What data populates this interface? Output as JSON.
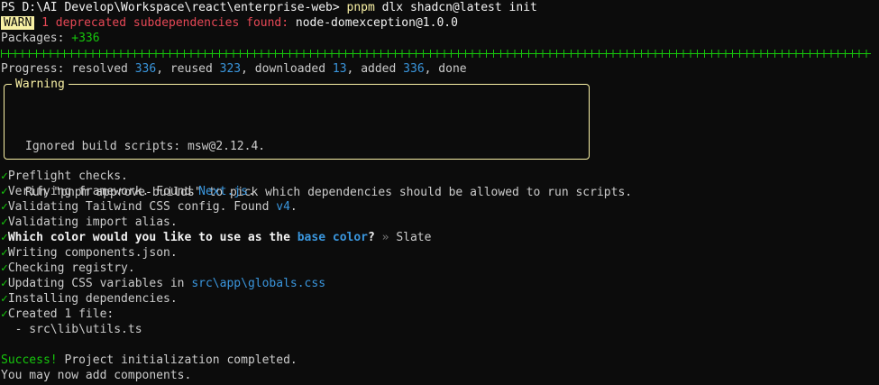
{
  "prompt": {
    "prefix": "PS D:\\AI Develop\\Workspace\\react\\enterprise-web> ",
    "command": "pnpm",
    "args": " dlx shadcn@latest init"
  },
  "warn": {
    "badge": "WARN",
    "message": " 1 deprecated subdependencies found: ",
    "package": "node-domexception@1.0.0"
  },
  "packages": {
    "label": "Packages: ",
    "count": "+336"
  },
  "progress": {
    "label": "Progress: resolved ",
    "resolved": "336",
    "reused_label": ", reused ",
    "reused": "323",
    "downloaded_label": ", downloaded ",
    "downloaded": "13",
    "added_label": ", added ",
    "added": "336",
    "done_label": ", done"
  },
  "warning_box": {
    "title": "Warning",
    "line1": "Ignored build scripts: msw@2.12.4.",
    "line2": "Run \"pnpm approve-builds\" to pick which dependencies should be allowed to run scripts."
  },
  "steps": {
    "check_glyph": "✓",
    "preflight": "Preflight checks.",
    "framework_prefix": "Verifying framework. Found ",
    "framework_value": "Next.js",
    "framework_suffix": ".",
    "tailwind_prefix": "Validating Tailwind CSS config. Found ",
    "tailwind_value": "v4",
    "tailwind_suffix": ".",
    "alias": "Validating import alias.",
    "color_q_prefix": "Which color would you like to use as the ",
    "color_q_highlight": "base color",
    "color_q_suffix": "?",
    "color_sep": " » ",
    "color_answer": "Slate",
    "components_json": "Writing components.json.",
    "registry": "Checking registry.",
    "css_vars_prefix": "Updating CSS variables in ",
    "css_vars_path": "src\\app\\globals.css",
    "install": "Installing dependencies.",
    "created": "Created 1 file:",
    "created_file": "  - src\\lib\\utils.ts"
  },
  "result": {
    "success_label": "Success!",
    "success_text": " Project initialization completed.",
    "next_line": "You may now add components."
  },
  "colors": {
    "background": "#0c0c0c",
    "foreground": "#cccccc",
    "yellow": "#f9f1a5",
    "green": "#16c60c",
    "red": "#e74856",
    "cyan": "#3a96dd"
  }
}
